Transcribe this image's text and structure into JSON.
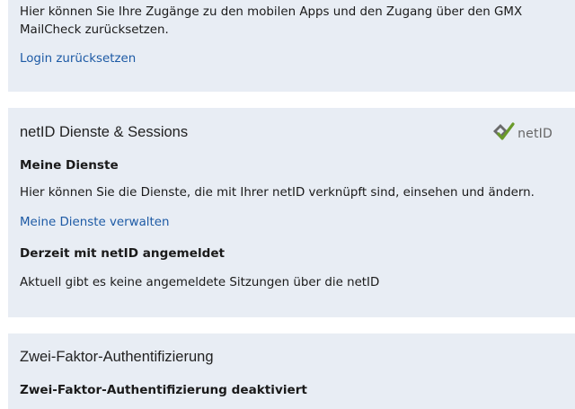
{
  "login_card": {
    "description_line1": "Hier können Sie Ihre Zugänge zu den mobilen Apps und den Zugang über den GMX",
    "description_line2": "MailCheck zurücksetzen.",
    "reset_link": "Login zurücksetzen"
  },
  "netid_card": {
    "title": "netID Dienste & Sessions",
    "logo_text": "netID",
    "services_heading": "Meine Dienste",
    "services_description": "Hier können Sie die Dienste, die mit Ihrer netID verknüpft sind, einsehen und ändern.",
    "services_link": "Meine Dienste verwalten",
    "sessions_heading": "Derzeit mit netID angemeldet",
    "sessions_description": "Aktuell gibt es keine angemeldete Sitzungen über die netID"
  },
  "two_factor_card": {
    "title": "Zwei-Faktor-Authentifizierung",
    "status_heading": "Zwei-Faktor-Authentifizierung deaktiviert"
  },
  "colors": {
    "card_background": "#e8edf4",
    "link": "#1d5aa5",
    "logo_check": "#6a9a2a",
    "logo_gray": "#6b6b6b"
  },
  "icons": {
    "netid_logo": "netid-checkmark-logo-icon"
  }
}
